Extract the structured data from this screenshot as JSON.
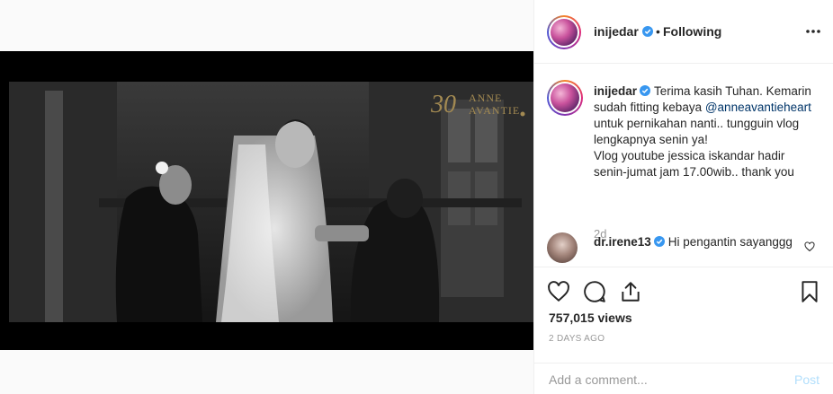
{
  "media": {
    "watermark_number": "30",
    "watermark_text_line1": "ANNE",
    "watermark_text_line2": "AVANTIE"
  },
  "header": {
    "username": "inijedar",
    "separator": "•",
    "follow_status": "Following",
    "more_icon": "more-horizontal-icon"
  },
  "caption": {
    "username": "inijedar",
    "text_part1": "Terima kasih Tuhan. Kemarin sudah fitting kebaya ",
    "mention": "@anneavantieheart",
    "text_part2": " untuk pernikahan nanti.. tungguin vlog lengkapnya senin ya!\nVlog youtube jessica iskandar hadir senin-jumat jam 17.00wib.. thank you",
    "age": "2d"
  },
  "comments": [
    {
      "username": "dr.irene13",
      "text": "Hi pengantin sayanggg"
    }
  ],
  "actions": {
    "icons": [
      "heart-icon",
      "comment-icon",
      "share-icon",
      "bookmark-icon"
    ],
    "views": "757,015 views",
    "timestamp": "2 DAYS AGO"
  },
  "add_comment": {
    "placeholder": "Add a comment...",
    "post_label": "Post"
  },
  "colors": {
    "verified": "#3897f0",
    "link": "#003569",
    "muted": "#999999",
    "post_disabled": "#b2dffc"
  }
}
